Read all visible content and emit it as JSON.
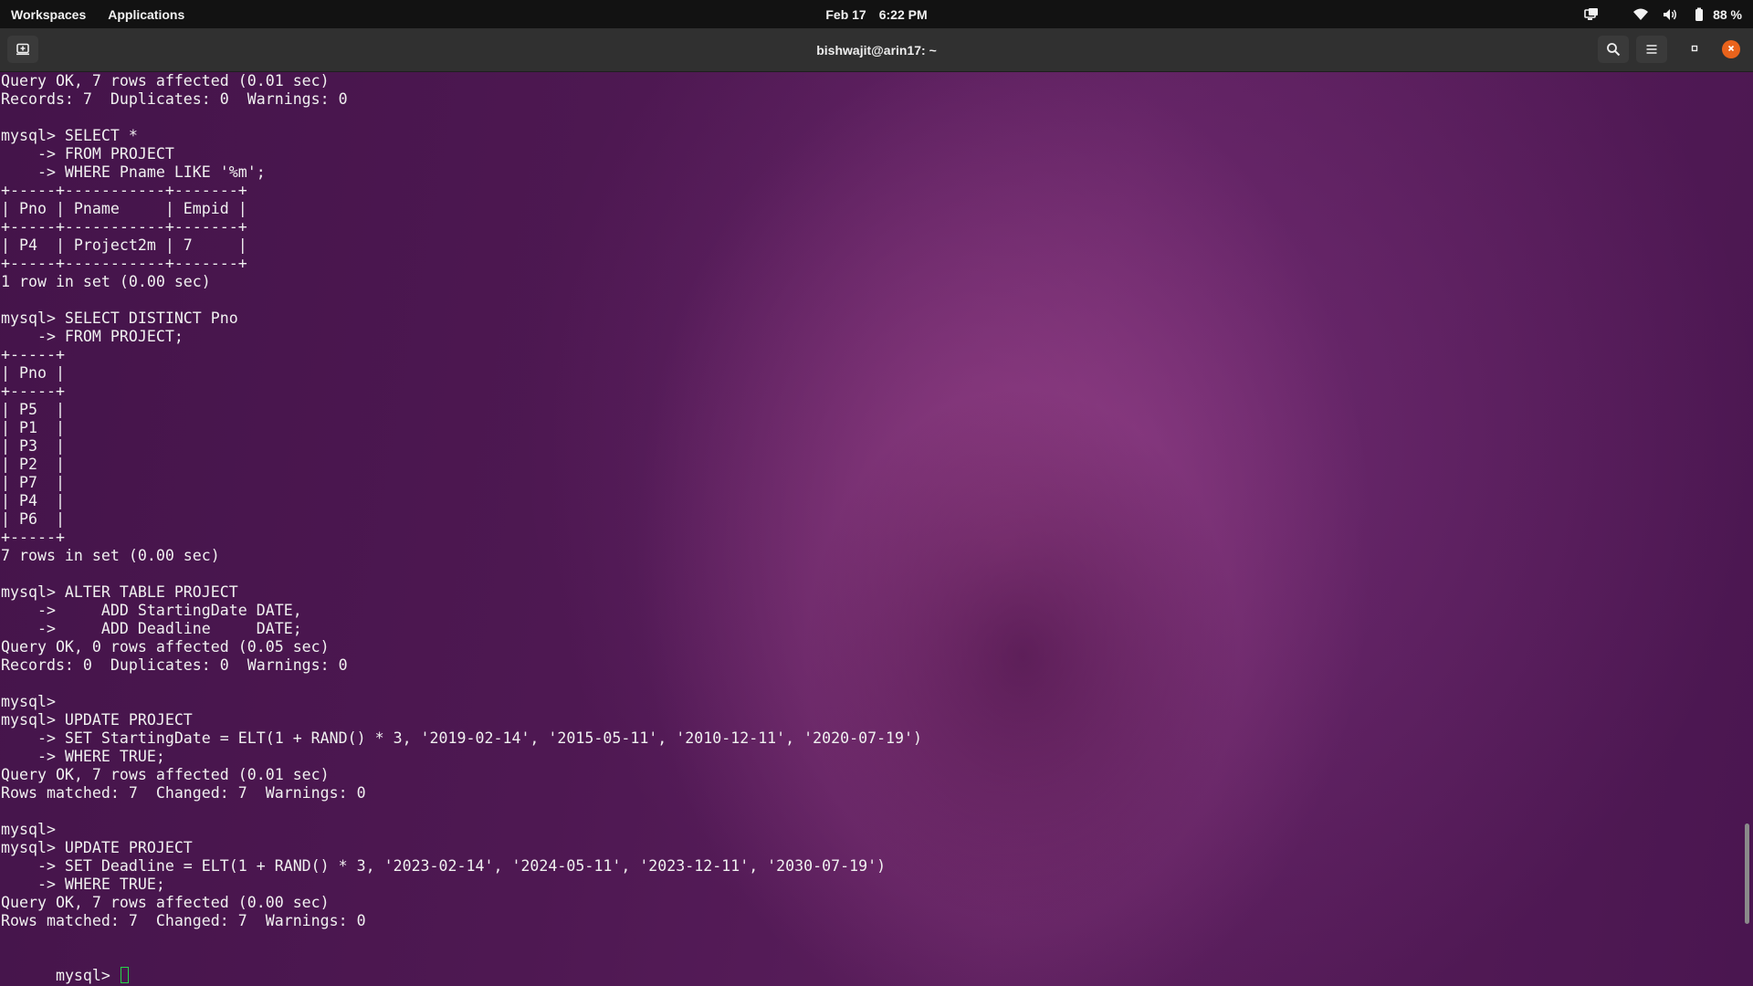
{
  "topbar": {
    "workspaces": "Workspaces",
    "applications": "Applications",
    "date": "Feb 17",
    "time": "6:22 PM",
    "battery_percent": "88 %",
    "icons": [
      "screen-share-icon",
      "wifi-icon",
      "volume-icon",
      "battery-icon"
    ]
  },
  "headerbar": {
    "title": "bishwajit@arin17: ~",
    "icons": [
      "new-tab-icon",
      "search-icon",
      "menu-icon",
      "minimize-icon",
      "close-icon"
    ]
  },
  "terminal": {
    "cursor_color": "#27d44a",
    "scrollbar_position": 0.93,
    "lines": [
      "Query OK, 7 rows affected (0.01 sec)",
      "Records: 7  Duplicates: 0  Warnings: 0",
      "",
      "mysql> SELECT *",
      "    -> FROM PROJECT",
      "    -> WHERE Pname LIKE '%m';",
      "+-----+-----------+-------+",
      "| Pno | Pname     | Empid |",
      "+-----+-----------+-------+",
      "| P4  | Project2m | 7     |",
      "+-----+-----------+-------+",
      "1 row in set (0.00 sec)",
      "",
      "mysql> SELECT DISTINCT Pno",
      "    -> FROM PROJECT;",
      "+-----+",
      "| Pno |",
      "+-----+",
      "| P5  |",
      "| P1  |",
      "| P3  |",
      "| P2  |",
      "| P7  |",
      "| P4  |",
      "| P6  |",
      "+-----+",
      "7 rows in set (0.00 sec)",
      "",
      "mysql> ALTER TABLE PROJECT",
      "    ->     ADD StartingDate DATE,",
      "    ->     ADD Deadline     DATE;",
      "Query OK, 0 rows affected (0.05 sec)",
      "Records: 0  Duplicates: 0  Warnings: 0",
      "",
      "mysql>",
      "mysql> UPDATE PROJECT",
      "    -> SET StartingDate = ELT(1 + RAND() * 3, '2019-02-14', '2015-05-11', '2010-12-11', '2020-07-19')",
      "    -> WHERE TRUE;",
      "Query OK, 7 rows affected (0.01 sec)",
      "Rows matched: 7  Changed: 7  Warnings: 0",
      "",
      "mysql>",
      "mysql> UPDATE PROJECT",
      "    -> SET Deadline = ELT(1 + RAND() * 3, '2023-02-14', '2024-05-11', '2023-12-11', '2030-07-19')",
      "    -> WHERE TRUE;",
      "Query OK, 7 rows affected (0.00 sec)",
      "Rows matched: 7  Changed: 7  Warnings: 0",
      ""
    ],
    "prompt": "mysql> "
  }
}
